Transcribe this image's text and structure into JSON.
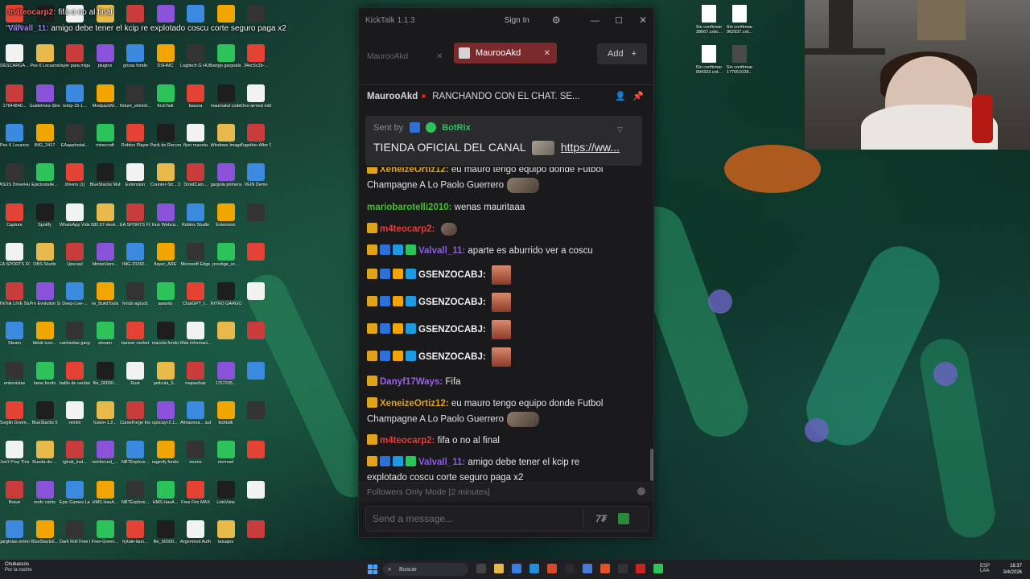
{
  "overlay_chat": [
    {
      "user": "m4teocarp2:",
      "text": "fifa o no al final"
    },
    {
      "user": "Valvall_11:",
      "text": "amigo debe tener el kcip re explotado coscu corte seguro paga x2"
    }
  ],
  "desktop_icons": [
    "reciclaje",
    "",
    "",
    "",
    "",
    "",
    "",
    "",
    "",
    "DESCARGA...",
    "Pes 6 Locazos",
    "fayer para miguel",
    "plugins",
    "grizas fondo",
    "DSHMC",
    "Logitech G HUB",
    "bango gargoals",
    "34ec5c2b-...",
    "17644840...",
    "Guidelines-Streams",
    "temp-15-1...",
    "ModpackM...",
    "fixture_eliminf...",
    "KickTalk",
    "basura",
    "mauroakd code",
    "One-armed robber",
    "Pes 6 Locazos",
    "IMG_2417",
    "EAappInstal...",
    "minecraft",
    "Roblox Player",
    "Pack de Recursos-...",
    "flyer maceta",
    "Windows Image 2026",
    "Together After Dark",
    "ASUS DriverHub",
    "Epicinstalle...",
    "drivers (1)",
    "BlueStacks Multi-Insta...",
    "Extension",
    "Counter-Str... 2",
    "DroidCam...",
    "gargola primera...",
    "VEIN Demo",
    "Capture",
    "Spotify",
    "WhatsApp Video 2025-...",
    "580.97-desk...",
    "EA SPORTS FC 26",
    "Iriun Webca...",
    "Roblox Studio",
    "Extension",
    "",
    "EA SPORTS FC 26",
    "OBS Studio",
    "Upscayl",
    "MinterHoro...",
    "IMG-20260...",
    "flayer_ARE",
    "Microsoft Edge",
    "prestige_sc...",
    "",
    "TikTok LIVE Studio",
    "Pro Evolution Soccer 6",
    "Deep-Live-...",
    "vs_BuildTools",
    "fondo agruck",
    "awards",
    "ChatGPT_I...",
    "INTRO GARGO...",
    "",
    "Steam",
    "tiktok-icon...",
    "camisetas gargolas",
    "stream",
    "banner roobet",
    "maceta fondo",
    "Más informaci...",
    "",
    "",
    "entrevistas",
    "bana fondo",
    "ballin de verdad",
    "file_00000...",
    "Rust",
    "pelicula_9...",
    "mapashax",
    "1767935...",
    "",
    "Burglin Gnom...",
    "BlueStacks 5",
    "remini",
    "fusion-1.2...",
    "CurseForge Installer",
    "upscayl-2.1...",
    "Almacena... automátic...",
    "kicktalk",
    "",
    "Don't Pray This Demon",
    "Rueda-de-...",
    "lghub_inst...",
    "reinforced_...",
    "NBTExplore...",
    "ragevfy fondo",
    "momo",
    "memuel",
    "",
    "Brave",
    "mofo cstrts",
    "Epic Games Launcher",
    "HMS.HasA...",
    "NBTExplore...",
    "HMS.HasA...",
    "Free Fire MAX",
    "LetsView",
    "",
    "gargtolas entrevistas",
    "BlueStacksI...",
    "Dark Roll Free Kic...",
    "Free-Green...",
    "hytale-laun...",
    "file_00000...",
    "Argenmod Auth",
    "tatuajes",
    ""
  ],
  "right_icons": [
    {
      "label": "Sin confirmar 38667.crdo..."
    },
    {
      "label": "Sin confirmar 962937.crd..."
    },
    {
      "label": "Sin confirmar 894333.crd..."
    },
    {
      "label": "Sin confirmar 177051028..."
    }
  ],
  "kicktalk": {
    "app_title": "KickTalk 1.1.3",
    "signin_label": "Sign In",
    "tabs": [
      {
        "label": "MaurooAkd",
        "active": false
      },
      {
        "label": "MaurooAkd",
        "active": true
      }
    ],
    "add_label": "Add",
    "channel": {
      "name": "MaurooAkd",
      "stream_title": "RANCHANDO CON EL CHAT. SE..."
    },
    "pinned": {
      "sent_by_label": "Sent by",
      "bot_name": "BotRix",
      "message": "TIENDA OFICIAL DEL CANAL",
      "link": "https://ww..."
    },
    "messages": [
      {
        "user": "XeneizeOrtiz12:",
        "user_color": "#e0a31c",
        "text": "eu mauro tengo equipo donde Futbol",
        "cont": "Champagne A Lo Paolo Guerrero",
        "partial": true
      },
      {
        "user": "mariobarotelli2010:",
        "user_color": "#41c12c",
        "text": "wenas mauritaaa"
      },
      {
        "user": "m4teocarp2:",
        "user_color": "#e33c3c",
        "text": ""
      },
      {
        "user": "Valvall_11:",
        "user_color": "#8a5ce3",
        "text": "aparte es aburrido ver a coscu"
      },
      {
        "user": "GSENZOCABJ:",
        "user_color": "#f0f0f0",
        "text": ""
      },
      {
        "user": "GSENZOCABJ:",
        "user_color": "#f0f0f0",
        "text": ""
      },
      {
        "user": "GSENZOCABJ:",
        "user_color": "#f0f0f0",
        "text": ""
      },
      {
        "user": "GSENZOCABJ:",
        "user_color": "#f0f0f0",
        "text": ""
      },
      {
        "user": "Danyf17Ways:",
        "user_color": "#9a62e6",
        "text": "Fifa"
      },
      {
        "user": "XeneizeOrtiz12:",
        "user_color": "#e0a31c",
        "text": "eu mauro tengo equipo donde Futbol",
        "cont": "Champagne A Lo Paolo Guerrero"
      },
      {
        "user": "m4teocarp2:",
        "user_color": "#e33c3c",
        "text": "fifa o no al final"
      },
      {
        "user": "Valvall_11:",
        "user_color": "#8a5ce3",
        "text": "amigo debe tener el kcip re",
        "cont": "explotado coscu corte seguro paga x2"
      }
    ],
    "followers_mode": "Followers Only Mode [2 minutes]",
    "composer_placeholder": "Send a message...",
    "emote_btn": "7₮"
  },
  "taskbar": {
    "weather_title": "Chubascos",
    "weather_sub": "Por la noche",
    "search_label": "Buscar",
    "tray_lang": "ESP",
    "tray_region": "LAA",
    "clock_time": "18:37",
    "clock_date": "3/4/2026"
  },
  "colors": {
    "accent_kick": "#2ec25b",
    "active_tab": "#7a2a2c",
    "window_bg": "#1a1a1c"
  }
}
